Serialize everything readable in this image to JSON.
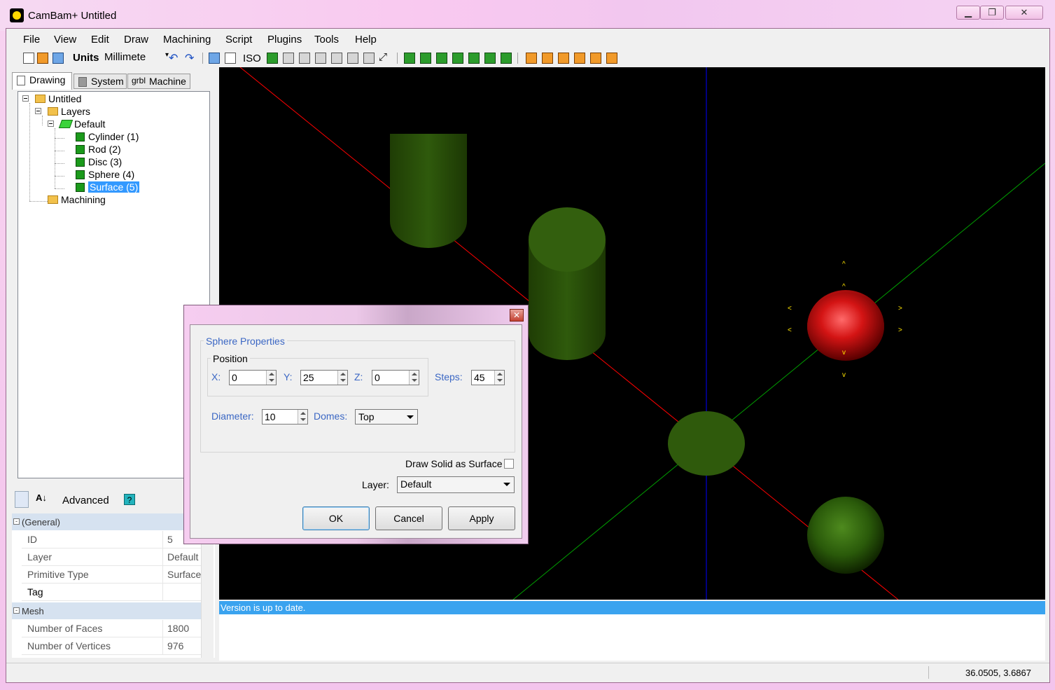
{
  "window": {
    "title": "CamBam+  Untitled"
  },
  "menu": [
    "File",
    "View",
    "Edit",
    "Draw",
    "Machining",
    "Script",
    "Plugins",
    "Tools",
    "Help"
  ],
  "toolbar": {
    "units_label": "Units",
    "units_value": "Millimete",
    "iso_label": "ISO"
  },
  "tabs": [
    "Drawing",
    "System",
    "Machine"
  ],
  "machine_tab_icon_text": "grbl",
  "tree": {
    "root": "Untitled",
    "layers": "Layers",
    "default_layer": "Default",
    "items": [
      "Cylinder (1)",
      "Rod (2)",
      "Disc (3)",
      "Sphere (4)",
      "Surface (5)"
    ],
    "selected": "Surface (5)",
    "machining": "Machining"
  },
  "propgrid": {
    "advanced_label": "Advanced",
    "help_label": "?",
    "categories": [
      {
        "name": "(General)",
        "rows": [
          {
            "key": "ID",
            "value": "5"
          },
          {
            "key": "Layer",
            "value": "Default"
          },
          {
            "key": "Primitive Type",
            "value": "Surface"
          },
          {
            "key": "Tag",
            "value": ""
          }
        ]
      },
      {
        "name": "Mesh",
        "rows": [
          {
            "key": "Number of Faces",
            "value": "1800"
          },
          {
            "key": "Number of Vertices",
            "value": "976"
          }
        ]
      }
    ]
  },
  "log": {
    "message": "Version is up to date."
  },
  "status": {
    "coords": "36.0505, 3.6867"
  },
  "dialog": {
    "group_title": "Sphere Properties",
    "position_title": "Position",
    "x_label": "X:",
    "x_value": "0",
    "y_label": "Y:",
    "y_value": "25",
    "z_label": "Z:",
    "z_value": "0",
    "steps_label": "Steps:",
    "steps_value": "45",
    "diameter_label": "Diameter:",
    "diameter_value": "10",
    "domes_label": "Domes:",
    "domes_value": "Top",
    "draw_solid_label": "Draw Solid as Surface",
    "layer_label": "Layer:",
    "layer_value": "Default",
    "ok": "OK",
    "cancel": "Cancel",
    "apply": "Apply",
    "close_label": "✕"
  },
  "colors": {
    "x_axis": "#ff0000",
    "y_axis": "#00aa00",
    "z_axis": "#0000ff",
    "selected": "#3399ff",
    "sphere_selected": "#e01010",
    "solid_green": "#3a6a10"
  }
}
